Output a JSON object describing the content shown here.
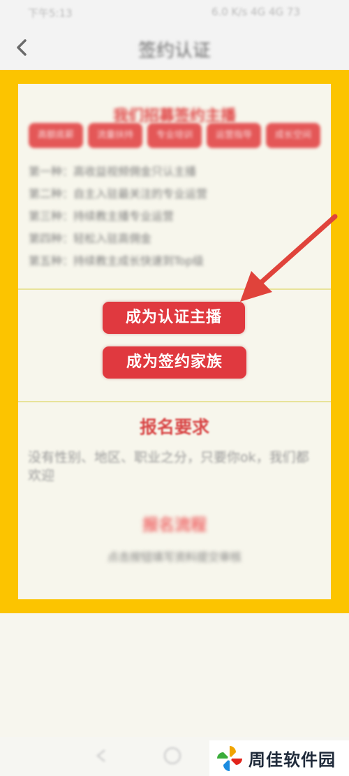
{
  "status_bar": {
    "time": "下午5:13",
    "indicators": "6.0 K/s 4G 4G 73"
  },
  "header": {
    "title": "签约认证",
    "back_icon": "chevron-left-icon"
  },
  "intro": {
    "title": "我们招募签约主播",
    "tags": [
      "高额底薪",
      "流量扶持",
      "专业培训",
      "运营指导",
      "成长空间"
    ],
    "rules": [
      "第一种：高收益视频佣金只认主播",
      "第二种：自主入驻最关注的专业运营",
      "第三种：持续教主播专业运营",
      "第四种：轻松入驻高佣金",
      "第五种：持续教主成长快速到Top级"
    ]
  },
  "buttons": {
    "certified_anchor": "成为认证主播",
    "signed_family": "成为签约家族"
  },
  "requirements": {
    "title": "报名要求",
    "text": "没有性别、地区、职业之分，只要你ok，我们都欢迎",
    "sub_title": "报名流程",
    "sub_text": "点击按钮填写资料提交审核"
  },
  "watermark": {
    "text": "周佳软件园"
  },
  "colors": {
    "frame": "#fcc400",
    "card": "#f7f6ec",
    "button": "#e0393f",
    "accent_text": "#d84545",
    "arrow": "#e0433b"
  }
}
